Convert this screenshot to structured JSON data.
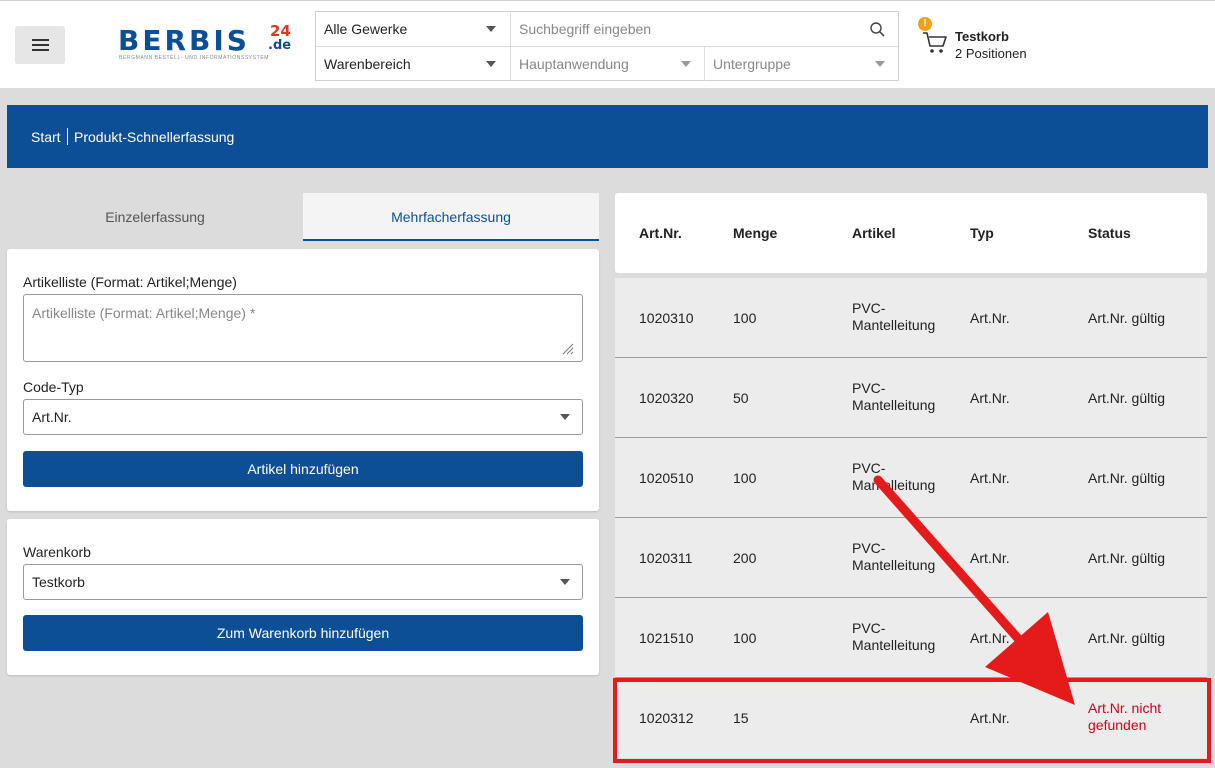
{
  "header": {
    "menu_icon": "hamburger-icon",
    "logo": {
      "main": "BERBIS",
      "num": "24",
      "tld": ".de",
      "tagline": "BERGMANN BESTELL- UND INFORMATIONSSYSTEM"
    },
    "search": {
      "trade_select": "Alle Gewerke",
      "search_placeholder": "Suchbegriff eingeben",
      "search_icon": "search-icon",
      "area_select": "Warenbereich",
      "main_use_select": "Hauptanwendung",
      "subgroup_select": "Untergruppe"
    },
    "cart": {
      "badge": "!",
      "icon": "cart-icon",
      "title": "Testkorb",
      "subtitle": "2 Positionen"
    }
  },
  "breadcrumb": {
    "start": "Start",
    "current": "Produkt-Schnellerfassung"
  },
  "tabs": {
    "single": "Einzelerfassung",
    "multi": "Mehrfacherfassung"
  },
  "form": {
    "articlelist_label": "Artikelliste (Format: Artikel;Menge)",
    "articlelist_placeholder": "Artikelliste (Format: Artikel;Menge) *",
    "codetype_label": "Code-Typ",
    "codetype_value": "Art.Nr.",
    "add_button": "Artikel hinzufügen"
  },
  "cart_form": {
    "label": "Warenkorb",
    "value": "Testkorb",
    "button": "Zum Warenkorb hinzufügen"
  },
  "table": {
    "headers": [
      "Art.Nr.",
      "Menge",
      "Artikel",
      "Typ",
      "Status"
    ],
    "rows": [
      {
        "artnr": "1020310",
        "menge": "100",
        "artikel_1": "PVC-",
        "artikel_2": "Mantelleitung",
        "typ": "Art.Nr.",
        "status": "Art.Nr. gültig"
      },
      {
        "artnr": "1020320",
        "menge": "50",
        "artikel_1": "PVC-",
        "artikel_2": "Mantelleitung",
        "typ": "Art.Nr.",
        "status": "Art.Nr. gültig"
      },
      {
        "artnr": "1020510",
        "menge": "100",
        "artikel_1": "PVC-",
        "artikel_2": "Mantelleitung",
        "typ": "Art.Nr.",
        "status": "Art.Nr. gültig"
      },
      {
        "artnr": "1020311",
        "menge": "200",
        "artikel_1": "PVC-",
        "artikel_2": "Mantelleitung",
        "typ": "Art.Nr.",
        "status": "Art.Nr. gültig"
      },
      {
        "artnr": "1021510",
        "menge": "100",
        "artikel_1": "PVC-",
        "artikel_2": "Mantelleitung",
        "typ": "Art.Nr.",
        "status": "Art.Nr. gültig"
      },
      {
        "artnr": "1020312",
        "menge": "15",
        "artikel_1": "",
        "artikel_2": "",
        "typ": "Art.Nr.",
        "status_1": "Art.Nr. nicht",
        "status_2": "gefunden"
      }
    ]
  },
  "colors": {
    "brand_blue": "#0d4f96",
    "error_red": "#d0021b",
    "annotation_red": "#e51a1a",
    "badge_orange": "#f0a01c"
  }
}
